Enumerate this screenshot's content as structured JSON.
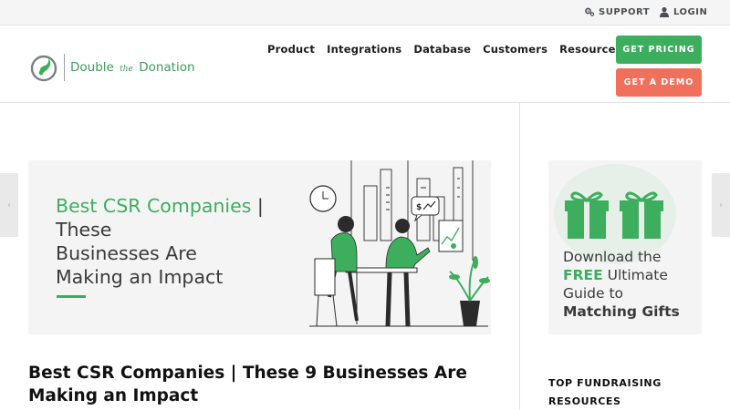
{
  "topbar": {
    "support_label": "SUPPORT",
    "support_icon": "gears-icon",
    "login_label": "LOGIN",
    "login_icon": "user-icon"
  },
  "header": {
    "logo": {
      "word1": "Double",
      "word2": "the",
      "word3": "Donation"
    },
    "nav": [
      "Product",
      "Integrations",
      "Database",
      "Customers",
      "Resources"
    ],
    "pricing_button": "GET PRICING",
    "demo_button": "GET A DEMO"
  },
  "colors": {
    "brand_green": "#3dae5e",
    "demo_coral": "#f0705c",
    "logo_gray": "#7a7f85"
  },
  "hero": {
    "title_green": "Best CSR Companies",
    "title_rest_1": " | These",
    "title_rest_2": "Businesses Are",
    "title_rest_3": "Making an Impact"
  },
  "article": {
    "title": "Best CSR Companies | These 9 Businesses Are Making an Impact"
  },
  "sidebar": {
    "ad_line1": "Download the",
    "ad_free": "FREE",
    "ad_line2_rest": " Ultimate",
    "ad_line3": "Guide to",
    "ad_line4": "Matching Gifts",
    "heading": "TOP FUNDRAISING RESOURCES"
  },
  "controls": {
    "prev_arrow": "‹",
    "next_arrow": "›"
  }
}
